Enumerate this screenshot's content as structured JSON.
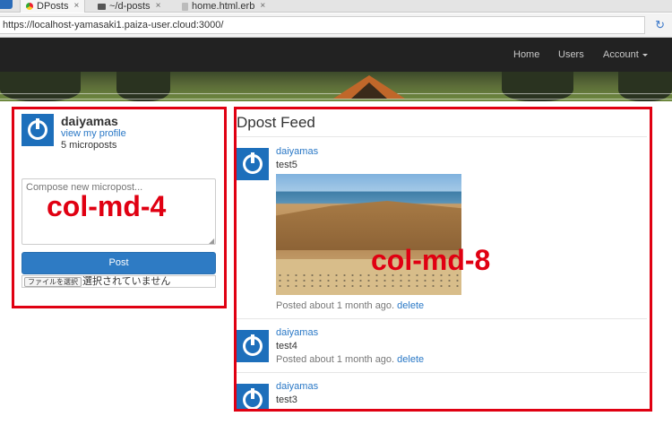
{
  "browser": {
    "tabs": [
      {
        "label": "DPosts",
        "active": true,
        "icon": "chrome-favicon"
      },
      {
        "label": "~/d-posts",
        "active": false,
        "icon": "terminal-icon"
      },
      {
        "label": "home.html.erb",
        "active": false,
        "icon": "file-icon"
      }
    ],
    "tab_close": "×",
    "url": "https://localhost-yamasaki1.paiza-user.cloud:3000/",
    "reload_icon": "↻"
  },
  "navbar": {
    "links": [
      "Home",
      "Users",
      "Account"
    ],
    "bg_color": "#222222"
  },
  "profile": {
    "name": "daiyamas",
    "link": "view my profile",
    "count": "5 microposts"
  },
  "compose": {
    "placeholder": "Compose new micropost...",
    "post_label": "Post",
    "file_button": "ファイルを選択",
    "file_status": "選択されていません",
    "accent": "#2e7bc4"
  },
  "feed": {
    "title": "Dpost Feed",
    "items": [
      {
        "user": "daiyamas",
        "content": "test5",
        "meta": "Posted about 1 month ago.",
        "delete": "delete",
        "has_image": true
      },
      {
        "user": "daiyamas",
        "content": "test4",
        "meta": "Posted about 1 month ago.",
        "delete": "delete",
        "has_image": false
      },
      {
        "user": "daiyamas",
        "content": "test3",
        "meta": "",
        "delete": "",
        "has_image": false
      }
    ]
  },
  "annotations": {
    "left": "col-md-4",
    "right": "col-md-8",
    "color": "#e00012"
  }
}
